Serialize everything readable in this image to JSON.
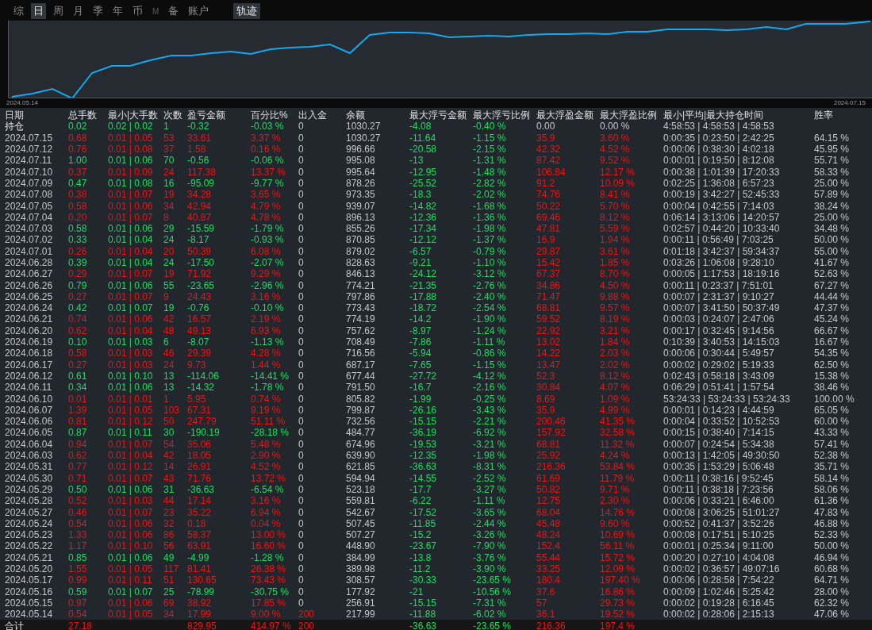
{
  "tabs": [
    {
      "label": "综",
      "selected": false,
      "disabled": false
    },
    {
      "label": "日",
      "selected": true,
      "disabled": false
    },
    {
      "label": "周",
      "selected": false,
      "disabled": false
    },
    {
      "label": "月",
      "selected": false,
      "disabled": false
    },
    {
      "label": "季",
      "selected": false,
      "disabled": false
    },
    {
      "label": "年",
      "selected": false,
      "disabled": false
    },
    {
      "label": "币",
      "selected": false,
      "disabled": false
    },
    {
      "label": "M",
      "selected": false,
      "disabled": true
    },
    {
      "label": "备",
      "selected": false,
      "disabled": false
    },
    {
      "label": "账户",
      "selected": false,
      "disabled": false
    }
  ],
  "view_button": {
    "label": "轨迹",
    "selected": true
  },
  "chart": {
    "start_label": "2024.05.14",
    "end_label": "2024.07.15"
  },
  "table": {
    "columns": [
      {
        "label": "日期",
        "kind": "plain"
      },
      {
        "label": "总手数",
        "kind": "trend"
      },
      {
        "label": "最小|大手数",
        "kind": "trend"
      },
      {
        "label": "次数",
        "kind": "trend"
      },
      {
        "label": "盈亏金额",
        "kind": "trend"
      },
      {
        "label": "百分比%",
        "kind": "trend"
      },
      {
        "label": "出入金",
        "kind": "deposit"
      },
      {
        "label": "余额",
        "kind": "plain"
      },
      {
        "label": "最大浮亏金额",
        "kind": "loss"
      },
      {
        "label": "最大浮亏比例",
        "kind": "loss"
      },
      {
        "label": "最大浮盈金额",
        "kind": "gain"
      },
      {
        "label": "最大浮盈比例",
        "kind": "gain"
      },
      {
        "label": "最小|平均|最大持仓时间",
        "kind": "plain"
      },
      {
        "label": "胜率",
        "kind": "plain"
      }
    ],
    "rows": [
      {
        "kind": "position",
        "profit": false,
        "deposit": false,
        "cells": [
          "持仓",
          "0.02",
          "0.02 | 0.02",
          "1",
          "-0.32",
          "-0.03 %",
          "0",
          "1030.27",
          "-4.08",
          "-0.40 %",
          "0.00",
          "0.00 %",
          "4:58:53 | 4:58:53 | 4:58:53",
          null
        ]
      },
      {
        "kind": "day",
        "profit": true,
        "deposit": false,
        "cells": [
          "2024.07.15",
          "0.68",
          "0.01 | 0.05",
          "53",
          "33.61",
          "3.37 %",
          "0",
          "1030.27",
          "-11.64",
          "-1.15 %",
          "35.9",
          "3.60 %",
          "0:00:35 | 0:23:50 | 2:42:25",
          "64.15 %"
        ]
      },
      {
        "kind": "day",
        "profit": true,
        "deposit": false,
        "cells": [
          "2024.07.12",
          "0.76",
          "0.01 | 0.08",
          "37",
          "1.58",
          "0.16 %",
          "0",
          "996.66",
          "-20.58",
          "-2.15 %",
          "42.32",
          "4.52 %",
          "0:00:06 | 0:38:30 | 4:02:18",
          "45.95 %"
        ]
      },
      {
        "kind": "day",
        "profit": false,
        "deposit": false,
        "cells": [
          "2024.07.11",
          "1.00",
          "0.01 | 0.06",
          "70",
          "-0.56",
          "-0.06 %",
          "0",
          "995.08",
          "-13",
          "-1.31 %",
          "87.42",
          "9.52 %",
          "0:00:01 | 0:19:50 | 8:12:08",
          "55.71 %"
        ]
      },
      {
        "kind": "day",
        "profit": true,
        "deposit": false,
        "cells": [
          "2024.07.10",
          "0.37",
          "0.01 | 0.09",
          "24",
          "117.38",
          "13.37 %",
          "0",
          "995.64",
          "-12.95",
          "-1.48 %",
          "106.84",
          "12.17 %",
          "0:00:38 | 1:01:39 | 17:20:33",
          "58.33 %"
        ]
      },
      {
        "kind": "day",
        "profit": false,
        "deposit": false,
        "cells": [
          "2024.07.09",
          "0.47",
          "0.01 | 0.08",
          "16",
          "-95.09",
          "-9.77 %",
          "0",
          "878.26",
          "-25.52",
          "-2.82 %",
          "91.2",
          "10.09 %",
          "0:02:25 | 1:36:08 | 6:57:23",
          "25.00 %"
        ]
      },
      {
        "kind": "day",
        "profit": true,
        "deposit": false,
        "cells": [
          "2024.07.08",
          "0.38",
          "0.01 | 0.07",
          "19",
          "34.28",
          "3.65 %",
          "0",
          "973.35",
          "-18.3",
          "-2.02 %",
          "74.76",
          "8.41 %",
          "0:00:19 | 3:42:27 | 52:45:33",
          "57.89 %"
        ]
      },
      {
        "kind": "day",
        "profit": true,
        "deposit": false,
        "cells": [
          "2024.07.05",
          "0.58",
          "0.01 | 0.06",
          "34",
          "42.94",
          "4.79 %",
          "0",
          "939.07",
          "-14.82",
          "-1.68 %",
          "50.22",
          "5.70 %",
          "0:00:04 | 0:42:55 | 7:14:03",
          "38.24 %"
        ]
      },
      {
        "kind": "day",
        "profit": true,
        "deposit": false,
        "cells": [
          "2024.07.04",
          "0.20",
          "0.01 | 0.07",
          "8",
          "40.87",
          "4.78 %",
          "0",
          "896.13",
          "-12.36",
          "-1.36 %",
          "69.46",
          "8.12 %",
          "0:06:14 | 3:13:06 | 14:20:57",
          "25.00 %"
        ]
      },
      {
        "kind": "day",
        "profit": false,
        "deposit": false,
        "cells": [
          "2024.07.03",
          "0.58",
          "0.01 | 0.06",
          "29",
          "-15.59",
          "-1.79 %",
          "0",
          "855.26",
          "-17.34",
          "-1.98 %",
          "47.81",
          "5.59 %",
          "0:02:57 | 0:44:20 | 10:33:40",
          "34.48 %"
        ]
      },
      {
        "kind": "day",
        "profit": false,
        "deposit": false,
        "cells": [
          "2024.07.02",
          "0.33",
          "0.01 | 0.04",
          "24",
          "-8.17",
          "-0.93 %",
          "0",
          "870.85",
          "-12.12",
          "-1.37 %",
          "16.9",
          "1.94 %",
          "0:00:11 | 0:56:49 | 7:03:25",
          "50.00 %"
        ]
      },
      {
        "kind": "day",
        "profit": true,
        "deposit": false,
        "cells": [
          "2024.07.01",
          "0.26",
          "0.01 | 0.04",
          "20",
          "50.39",
          "6.08 %",
          "0",
          "879.02",
          "-6.57",
          "-0.79 %",
          "29.87",
          "3.61 %",
          "0:01:18 | 3:42:37 | 59:34:37",
          "55.00 %"
        ]
      },
      {
        "kind": "day",
        "profit": false,
        "deposit": false,
        "cells": [
          "2024.06.28",
          "0.39",
          "0.01 | 0.04",
          "24",
          "-17.50",
          "-2.07 %",
          "0",
          "828.63",
          "-9.21",
          "-1.10 %",
          "15.42",
          "1.85 %",
          "0:03:26 | 1:06:08 | 9:28:10",
          "41.67 %"
        ]
      },
      {
        "kind": "day",
        "profit": true,
        "deposit": false,
        "cells": [
          "2024.06.27",
          "0.29",
          "0.01 | 0.07",
          "19",
          "71.92",
          "9.29 %",
          "0",
          "846.13",
          "-24.12",
          "-3.12 %",
          "67.37",
          "8.70 %",
          "0:00:05 | 1:17:53 | 18:19:16",
          "52.63 %"
        ]
      },
      {
        "kind": "day",
        "profit": false,
        "deposit": false,
        "cells": [
          "2024.06.26",
          "0.79",
          "0.01 | 0.06",
          "55",
          "-23.65",
          "-2.96 %",
          "0",
          "774.21",
          "-21.35",
          "-2.76 %",
          "34.86",
          "4.50 %",
          "0:00:11 | 0:23:37 | 7:51:01",
          "67.27 %"
        ]
      },
      {
        "kind": "day",
        "profit": true,
        "deposit": false,
        "cells": [
          "2024.06.25",
          "0.27",
          "0.01 | 0.07",
          "9",
          "24.43",
          "3.16 %",
          "0",
          "797.86",
          "-17.88",
          "-2.40 %",
          "71.47",
          "9.88 %",
          "0:00:07 | 2:31:37 | 9:10:27",
          "44.44 %"
        ]
      },
      {
        "kind": "day",
        "profit": false,
        "deposit": false,
        "cells": [
          "2024.06.24",
          "0.42",
          "0.01 | 0.07",
          "19",
          "-0.76",
          "-0.10 %",
          "0",
          "773.43",
          "-18.72",
          "-2.54 %",
          "68.81",
          "9.57 %",
          "0:00:07 | 3:41:50 | 50:37:49",
          "47.37 %"
        ]
      },
      {
        "kind": "day",
        "profit": true,
        "deposit": false,
        "cells": [
          "2024.06.21",
          "0.74",
          "0.01 | 0.06",
          "42",
          "16.57",
          "2.19 %",
          "0",
          "774.19",
          "-14.2",
          "-1.90 %",
          "59.52",
          "8.19 %",
          "0:00:03 | 0:24:07 | 2:47:06",
          "45.24 %"
        ]
      },
      {
        "kind": "day",
        "profit": true,
        "deposit": false,
        "cells": [
          "2024.06.20",
          "0.62",
          "0.01 | 0.04",
          "48",
          "49.13",
          "6.93 %",
          "0",
          "757.62",
          "-8.97",
          "-1.24 %",
          "22.92",
          "3.21 %",
          "0:00:17 | 0:32:45 | 9:14:56",
          "66.67 %"
        ]
      },
      {
        "kind": "day",
        "profit": false,
        "deposit": false,
        "cells": [
          "2024.06.19",
          "0.10",
          "0.01 | 0.03",
          "6",
          "-8.07",
          "-1.13 %",
          "0",
          "708.49",
          "-7.86",
          "-1.11 %",
          "13.02",
          "1.84 %",
          "0:10:39 | 3:40:53 | 14:15:03",
          "16.67 %"
        ]
      },
      {
        "kind": "day",
        "profit": true,
        "deposit": false,
        "cells": [
          "2024.06.18",
          "0.58",
          "0.01 | 0.03",
          "46",
          "29.39",
          "4.28 %",
          "0",
          "716.56",
          "-5.94",
          "-0.86 %",
          "14.22",
          "2.03 %",
          "0:00:06 | 0:30:44 | 5:49:57",
          "54.35 %"
        ]
      },
      {
        "kind": "day",
        "profit": true,
        "deposit": false,
        "cells": [
          "2024.06.17",
          "0.27",
          "0.01 | 0.03",
          "24",
          "9.73",
          "1.44 %",
          "0",
          "687.17",
          "-7.65",
          "-1.15 %",
          "13.47",
          "2.02 %",
          "0:00:02 | 0:29:02 | 5:19:33",
          "62.50 %"
        ]
      },
      {
        "kind": "day",
        "profit": false,
        "deposit": false,
        "cells": [
          "2024.06.12",
          "0.61",
          "0.01 | 0.10",
          "13",
          "-114.06",
          "-14.41 %",
          "0",
          "677.44",
          "-27.72",
          "-4.12 %",
          "52.3",
          "8.12 %",
          "0:02:43 | 0:58:18 | 3:43:09",
          "15.38 %"
        ]
      },
      {
        "kind": "day",
        "profit": false,
        "deposit": false,
        "cells": [
          "2024.06.11",
          "0.34",
          "0.01 | 0.06",
          "13",
          "-14.32",
          "-1.78 %",
          "0",
          "791.50",
          "-16.7",
          "-2.16 %",
          "30.84",
          "4.07 %",
          "0:06:29 | 0:51:41 | 1:57:54",
          "38.46 %"
        ]
      },
      {
        "kind": "day",
        "profit": true,
        "deposit": false,
        "cells": [
          "2024.06.10",
          "0.01",
          "0.01 | 0.01",
          "1",
          "5.95",
          "0.74 %",
          "0",
          "805.82",
          "-1.99",
          "-0.25 %",
          "8.69",
          "1.09 %",
          "53:24:33 | 53:24:33 | 53:24:33",
          "100.00 %"
        ]
      },
      {
        "kind": "day",
        "profit": true,
        "deposit": false,
        "cells": [
          "2024.06.07",
          "1.39",
          "0.01 | 0.05",
          "103",
          "67.31",
          "9.19 %",
          "0",
          "799.87",
          "-26.16",
          "-3.43 %",
          "35.9",
          "4.99 %",
          "0:00:01 | 0:14:23 | 4:44:59",
          "65.05 %"
        ]
      },
      {
        "kind": "day",
        "profit": true,
        "deposit": false,
        "cells": [
          "2024.06.06",
          "0.81",
          "0.01 | 0.12",
          "50",
          "247.79",
          "51.11 %",
          "0",
          "732.56",
          "-15.15",
          "-2.21 %",
          "200.46",
          "41.35 %",
          "0:00:04 | 0:33:52 | 10:52:53",
          "60.00 %"
        ]
      },
      {
        "kind": "day",
        "profit": false,
        "deposit": false,
        "cells": [
          "2024.06.05",
          "0.87",
          "0.01 | 0.11",
          "30",
          "-190.19",
          "-28.18 %",
          "0",
          "484.77",
          "-36.19",
          "-6.92 %",
          "157.92",
          "32.58 %",
          "0:00:15 | 0:38:40 | 7:14:15",
          "43.33 %"
        ]
      },
      {
        "kind": "day",
        "profit": true,
        "deposit": false,
        "cells": [
          "2024.06.04",
          "0.94",
          "0.01 | 0.07",
          "54",
          "35.06",
          "5.48 %",
          "0",
          "674.96",
          "-19.53",
          "-3.21 %",
          "68.81",
          "11.32 %",
          "0:00:07 | 0:24:54 | 5:34:38",
          "57.41 %"
        ]
      },
      {
        "kind": "day",
        "profit": true,
        "deposit": false,
        "cells": [
          "2024.06.03",
          "0.62",
          "0.01 | 0.04",
          "42",
          "18.05",
          "2.90 %",
          "0",
          "639.90",
          "-12.35",
          "-1.98 %",
          "25.92",
          "4.24 %",
          "0:00:13 | 1:42:05 | 49:30:50",
          "52.38 %"
        ]
      },
      {
        "kind": "day",
        "profit": true,
        "deposit": false,
        "cells": [
          "2024.05.31",
          "0.77",
          "0.01 | 0.12",
          "14",
          "26.91",
          "4.52 %",
          "0",
          "621.85",
          "-36.63",
          "-8.31 %",
          "216.36",
          "53.84 %",
          "0:00:35 | 1:53:29 | 5:06:48",
          "35.71 %"
        ]
      },
      {
        "kind": "day",
        "profit": true,
        "deposit": false,
        "cells": [
          "2024.05.30",
          "0.71",
          "0.01 | 0.07",
          "43",
          "71.76",
          "13.72 %",
          "0",
          "594.94",
          "-14.55",
          "-2.52 %",
          "61.69",
          "11.79 %",
          "0:00:11 | 0:38:16 | 9:52:45",
          "58.14 %"
        ]
      },
      {
        "kind": "day",
        "profit": false,
        "deposit": false,
        "cells": [
          "2024.05.29",
          "0.50",
          "0.01 | 0.06",
          "31",
          "-36.63",
          "-6.54 %",
          "0",
          "523.18",
          "-17.7",
          "-3.27 %",
          "50.82",
          "9.71 %",
          "0:00:11 | 0:38:18 | 7:23:56",
          "58.06 %"
        ]
      },
      {
        "kind": "day",
        "profit": true,
        "deposit": false,
        "cells": [
          "2024.05.28",
          "0.52",
          "0.01 | 0.03",
          "44",
          "17.14",
          "3.16 %",
          "0",
          "559.81",
          "-6.22",
          "-1.11 %",
          "12.75",
          "2.30 %",
          "0:00:06 | 0:33:21 | 6:46:00",
          "61.36 %"
        ]
      },
      {
        "kind": "day",
        "profit": true,
        "deposit": false,
        "cells": [
          "2024.05.27",
          "0.46",
          "0.01 | 0.07",
          "23",
          "35.22",
          "6.94 %",
          "0",
          "542.67",
          "-17.52",
          "-3.65 %",
          "68.04",
          "14.76 %",
          "0:00:08 | 3:06:25 | 51:01:27",
          "47.83 %"
        ]
      },
      {
        "kind": "day",
        "profit": true,
        "deposit": false,
        "cells": [
          "2024.05.24",
          "0.54",
          "0.01 | 0.06",
          "32",
          "0.18",
          "0.04 %",
          "0",
          "507.45",
          "-11.85",
          "-2.44 %",
          "45.48",
          "9.60 %",
          "0:00:52 | 0:41:37 | 3:52:26",
          "46.88 %"
        ]
      },
      {
        "kind": "day",
        "profit": true,
        "deposit": false,
        "cells": [
          "2024.05.23",
          "1.33",
          "0.01 | 0.06",
          "86",
          "58.37",
          "13.00 %",
          "0",
          "507.27",
          "-15.2",
          "-3.26 %",
          "48.24",
          "10.69 %",
          "0:00:08 | 0:17:51 | 5:10:25",
          "52.33 %"
        ]
      },
      {
        "kind": "day",
        "profit": true,
        "deposit": false,
        "cells": [
          "2024.05.22",
          "1.17",
          "0.01 | 0.10",
          "56",
          "63.91",
          "16.60 %",
          "0",
          "448.90",
          "-23.67",
          "-7.90 %",
          "152.4",
          "56.11 %",
          "0:00:01 | 0:25:34 | 9:11:00",
          "50.00 %"
        ]
      },
      {
        "kind": "day",
        "profit": false,
        "deposit": false,
        "cells": [
          "2024.05.21",
          "0.85",
          "0.01 | 0.06",
          "49",
          "-4.99",
          "-1.28 %",
          "0",
          "384.99",
          "-13.8",
          "-3.76 %",
          "55.44",
          "15.72 %",
          "0:00:20 | 0:27:10 | 4:04:08",
          "46.94 %"
        ]
      },
      {
        "kind": "day",
        "profit": true,
        "deposit": false,
        "cells": [
          "2024.05.20",
          "1.55",
          "0.01 | 0.05",
          "117",
          "81.41",
          "26.38 %",
          "0",
          "389.98",
          "-11.2",
          "-3.90 %",
          "33.25",
          "12.09 %",
          "0:00:02 | 0:36:57 | 49:07:16",
          "60.68 %"
        ]
      },
      {
        "kind": "day",
        "profit": true,
        "deposit": false,
        "cells": [
          "2024.05.17",
          "0.99",
          "0.01 | 0.11",
          "51",
          "130.65",
          "73.43 %",
          "0",
          "308.57",
          "-30.33",
          "-23.65 %",
          "180.4",
          "197.40 %",
          "0:00:06 | 0:28:58 | 7:54:22",
          "64.71 %"
        ]
      },
      {
        "kind": "day",
        "profit": false,
        "deposit": false,
        "cells": [
          "2024.05.16",
          "0.59",
          "0.01 | 0.07",
          "25",
          "-78.99",
          "-30.75 %",
          "0",
          "177.92",
          "-21",
          "-10.56 %",
          "37.6",
          "16.86 %",
          "0:00:09 | 1:02:46 | 5:25:42",
          "28.00 %"
        ]
      },
      {
        "kind": "day",
        "profit": true,
        "deposit": false,
        "cells": [
          "2024.05.15",
          "0.97",
          "0.01 | 0.06",
          "69",
          "38.92",
          "17.85 %",
          "0",
          "256.91",
          "-15.15",
          "-7.31 %",
          "57",
          "29.73 %",
          "0:00:02 | 0:19:28 | 6:16:45",
          "62.32 %"
        ]
      },
      {
        "kind": "day",
        "profit": true,
        "deposit": true,
        "cells": [
          "2024.05.14",
          "0.54",
          "0.01 | 0.05",
          "34",
          "17.99",
          "9.00 %",
          "200",
          "217.99",
          "-11.88",
          "-6.02 %",
          "36.1",
          "19.52 %",
          "0:00:02 | 0:28:06 | 2:15:13",
          "47.06 %"
        ]
      },
      {
        "kind": "total",
        "profit": true,
        "deposit": true,
        "cells": [
          "合计",
          "27.18",
          null,
          null,
          "829.95",
          "414.97 %",
          "200",
          null,
          "-36.63",
          "-23.65 %",
          "216.36",
          "197.4 %",
          null,
          null
        ]
      }
    ]
  }
}
